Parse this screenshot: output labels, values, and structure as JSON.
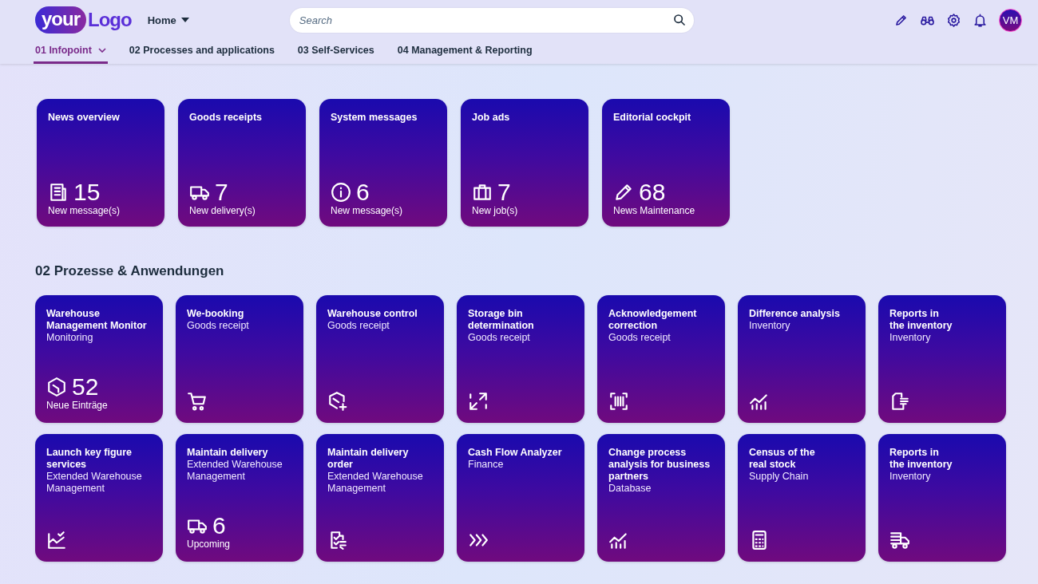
{
  "header": {
    "logo": {
      "word_1": "your",
      "word_2": "Logo"
    },
    "home_menu": "Home",
    "search": {
      "placeholder": "Search"
    },
    "avatar": "VM"
  },
  "tabs": [
    {
      "label": "01 Infopoint",
      "selected": true,
      "has_menu": true
    },
    {
      "label": "02 Processes and applications",
      "selected": false,
      "has_menu": false
    },
    {
      "label": "03 Self-Services",
      "selected": false,
      "has_menu": false
    },
    {
      "label": "04 Management & Reporting",
      "selected": false,
      "has_menu": false
    }
  ],
  "infopoint_tiles": [
    {
      "title": [
        "News overview"
      ],
      "value": "15",
      "unit": "New message(s)"
    },
    {
      "title": [
        "Goods receipts"
      ],
      "value": "7",
      "unit": "New delivery(s)"
    },
    {
      "title": [
        "System messages"
      ],
      "value": "6",
      "unit": "New message(s)"
    },
    {
      "title": [
        "Job ads"
      ],
      "value": "7",
      "unit": "New job(s)"
    },
    {
      "title": [
        "Editorial cockpit"
      ],
      "value": "68",
      "unit": "News Maintenance"
    }
  ],
  "section_title": "02 Prozesse & Anwendungen",
  "app_tiles": [
    {
      "title": [
        "Warehouse",
        "Management Monitor"
      ],
      "subtitle": [
        "Monitoring"
      ],
      "value": "52",
      "unit": "Neue Einträge"
    },
    {
      "title": [
        "We-booking"
      ],
      "subtitle": [
        "Goods receipt"
      ]
    },
    {
      "title": [
        "Warehouse control"
      ],
      "subtitle": [
        "Goods receipt"
      ]
    },
    {
      "title": [
        "Storage bin",
        "determination"
      ],
      "subtitle": [
        "Goods receipt"
      ]
    },
    {
      "title": [
        "Acknowledgement",
        "correction"
      ],
      "subtitle": [
        "Goods receipt"
      ]
    },
    {
      "title": [
        "Difference analysis"
      ],
      "subtitle": [
        "Inventory"
      ]
    },
    {
      "title": [
        "Reports in",
        "the inventory"
      ],
      "subtitle": [
        "Inventory"
      ]
    },
    {
      "title": [
        "Launch key figure",
        "services"
      ],
      "subtitle": [
        "Extended Warehouse",
        "Management"
      ]
    },
    {
      "title": [
        "Maintain delivery"
      ],
      "subtitle": [
        "Extended Warehouse",
        "Management"
      ],
      "value": "6",
      "unit": "Upcoming"
    },
    {
      "title": [
        "Maintain delivery",
        "order"
      ],
      "subtitle": [
        "Extended Warehouse",
        "Management"
      ]
    },
    {
      "title": [
        "Cash Flow Analyzer"
      ],
      "subtitle": [
        "Finance"
      ]
    },
    {
      "title": [
        "Change process",
        "analysis for business",
        "partners"
      ],
      "subtitle": [
        "Database"
      ]
    },
    {
      "title": [
        "Census of the",
        "real stock"
      ],
      "subtitle": [
        "Supply Chain"
      ]
    },
    {
      "title": [
        "Reports in",
        "the inventory"
      ],
      "subtitle": [
        "Inventory"
      ]
    }
  ]
}
